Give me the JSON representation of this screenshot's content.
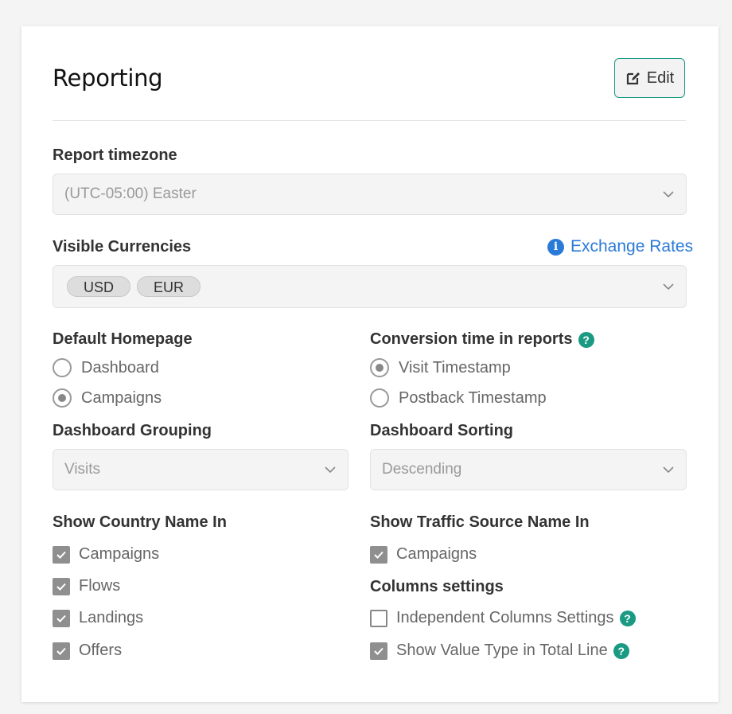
{
  "header": {
    "title": "Reporting",
    "edit_label": "Edit"
  },
  "timezone": {
    "label": "Report timezone",
    "value": "(UTC-05:00) Easter"
  },
  "currencies": {
    "label": "Visible Currencies",
    "exchange_link": "Exchange Rates",
    "tags": [
      "USD",
      "EUR"
    ]
  },
  "homepage": {
    "label": "Default Homepage",
    "options": [
      {
        "label": "Dashboard",
        "selected": false
      },
      {
        "label": "Campaigns",
        "selected": true
      }
    ]
  },
  "conversion_time": {
    "label": "Conversion time in reports",
    "options": [
      {
        "label": "Visit Timestamp",
        "selected": true
      },
      {
        "label": "Postback Timestamp",
        "selected": false
      }
    ]
  },
  "grouping": {
    "label": "Dashboard Grouping",
    "value": "Visits"
  },
  "sorting": {
    "label": "Dashboard Sorting",
    "value": "Descending"
  },
  "country_name": {
    "label": "Show Country Name In",
    "items": [
      {
        "label": "Campaigns",
        "checked": true
      },
      {
        "label": "Flows",
        "checked": true
      },
      {
        "label": "Landings",
        "checked": true
      },
      {
        "label": "Offers",
        "checked": true
      }
    ]
  },
  "traffic_source_name": {
    "label": "Show Traffic Source Name In",
    "items": [
      {
        "label": "Campaigns",
        "checked": true
      }
    ]
  },
  "columns": {
    "label": "Columns settings",
    "items": [
      {
        "label": "Independent Columns Settings",
        "checked": false
      },
      {
        "label": "Show Value Type in Total Line",
        "checked": true
      }
    ]
  },
  "colors": {
    "accent": "#1a9a82",
    "link": "#2a7ad8"
  },
  "icons": {
    "edit": "edit-icon",
    "info": "info-icon",
    "help": "help-icon",
    "chevron": "chevron-down-icon",
    "check": "check-icon"
  }
}
